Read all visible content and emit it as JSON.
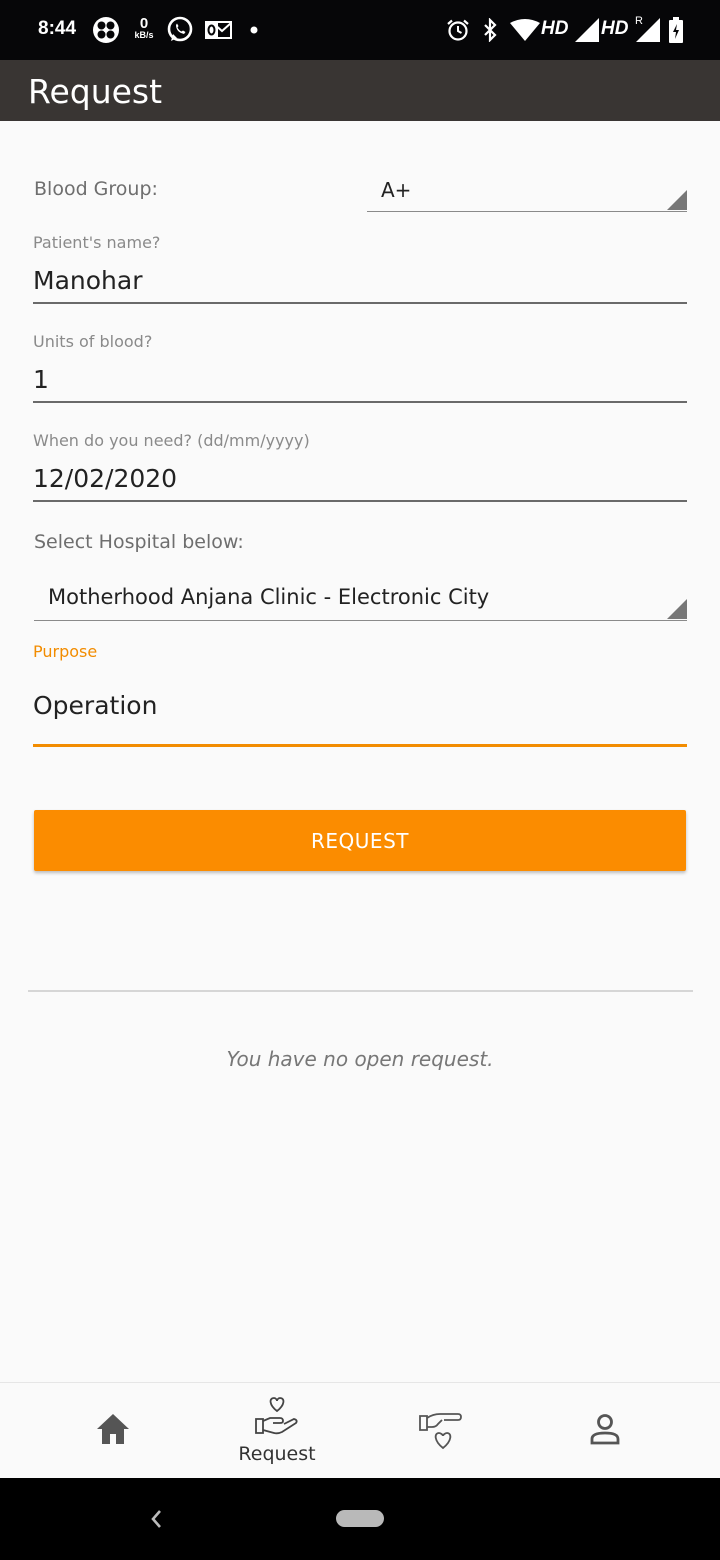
{
  "status_bar": {
    "time": "8:44",
    "speed_value": "0",
    "speed_unit": "kB/s",
    "hd_1": "HD",
    "hd_2": "HD",
    "roaming": "R",
    "icons": [
      "fan-icon",
      "whatsapp-icon",
      "outlook-icon",
      "dot-icon",
      "alarm-icon",
      "bluetooth-icon",
      "wifi-icon",
      "signal-icon",
      "signal-icon",
      "battery-charging-icon"
    ]
  },
  "app_bar": {
    "title": "Request"
  },
  "form": {
    "blood_group_label": "Blood Group:",
    "blood_group_value": "A+",
    "patient_label": "Patient's name?",
    "patient_value": "Manohar",
    "units_label": "Units of blood?",
    "units_value": "1",
    "date_label": "When do you need? (dd/mm/yyyy)",
    "date_value": "12/02/2020",
    "hospital_label": "Select Hospital below:",
    "hospital_value": "Motherhood Anjana Clinic - Electronic City",
    "purpose_label": "Purpose",
    "purpose_value": "Operation",
    "request_button": "REQUEST"
  },
  "requests": {
    "empty_message": "You have no open request."
  },
  "bottom_nav": {
    "items": [
      {
        "icon": "home-icon",
        "label": ""
      },
      {
        "icon": "request-blood-icon",
        "label": "Request"
      },
      {
        "icon": "donate-icon",
        "label": ""
      },
      {
        "icon": "profile-icon",
        "label": ""
      }
    ]
  },
  "colors": {
    "accent": "#fb8c00",
    "app_bar": "#393533",
    "status_bar": "#060608"
  }
}
